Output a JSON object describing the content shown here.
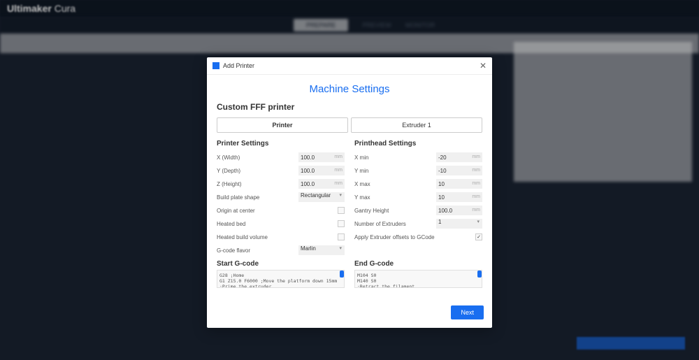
{
  "app": {
    "logo_brand": "Ultimaker",
    "logo_product": "Cura"
  },
  "nav": {
    "prepare": "PREPARE",
    "preview": "PREVIEW",
    "monitor": "MONITOR"
  },
  "modal": {
    "window_title": "Add Printer",
    "close": "✕",
    "title": "Machine Settings",
    "printer_name": "Custom FFF printer",
    "tabs": {
      "printer": "Printer",
      "extruder": "Extruder 1"
    },
    "printer_settings": {
      "heading": "Printer Settings",
      "x_width": {
        "label": "X (Width)",
        "value": "100.0",
        "unit": "mm"
      },
      "y_depth": {
        "label": "Y (Depth)",
        "value": "100.0",
        "unit": "mm"
      },
      "z_height": {
        "label": "Z (Height)",
        "value": "100.0",
        "unit": "mm"
      },
      "build_plate": {
        "label": "Build plate shape",
        "value": "Rectangular"
      },
      "origin": {
        "label": "Origin at center",
        "checked": false
      },
      "heated_bed": {
        "label": "Heated bed",
        "checked": false
      },
      "heated_vol": {
        "label": "Heated build volume",
        "checked": false
      },
      "gcode_flavor": {
        "label": "G-code flavor",
        "value": "Marlin"
      }
    },
    "printhead_settings": {
      "heading": "Printhead Settings",
      "x_min": {
        "label": "X min",
        "value": "-20",
        "unit": "mm"
      },
      "y_min": {
        "label": "Y min",
        "value": "-10",
        "unit": "mm"
      },
      "x_max": {
        "label": "X max",
        "value": "10",
        "unit": "mm"
      },
      "y_max": {
        "label": "Y max",
        "value": "10",
        "unit": "mm"
      },
      "gantry": {
        "label": "Gantry Height",
        "value": "100.0",
        "unit": "mm"
      },
      "extruders": {
        "label": "Number of Extruders",
        "value": "1"
      },
      "offsets": {
        "label": "Apply Extruder offsets to GCode",
        "checked": true
      }
    },
    "start_gcode": {
      "heading": "Start G-code",
      "content": "G28 ;Home\nG1 Z15.0 F6000 ;Move the platform down 15mm\n;Prime the extruder"
    },
    "end_gcode": {
      "heading": "End G-code",
      "content": "M104 S0\nM140 S0\n;Retract the filament"
    },
    "next": "Next"
  }
}
